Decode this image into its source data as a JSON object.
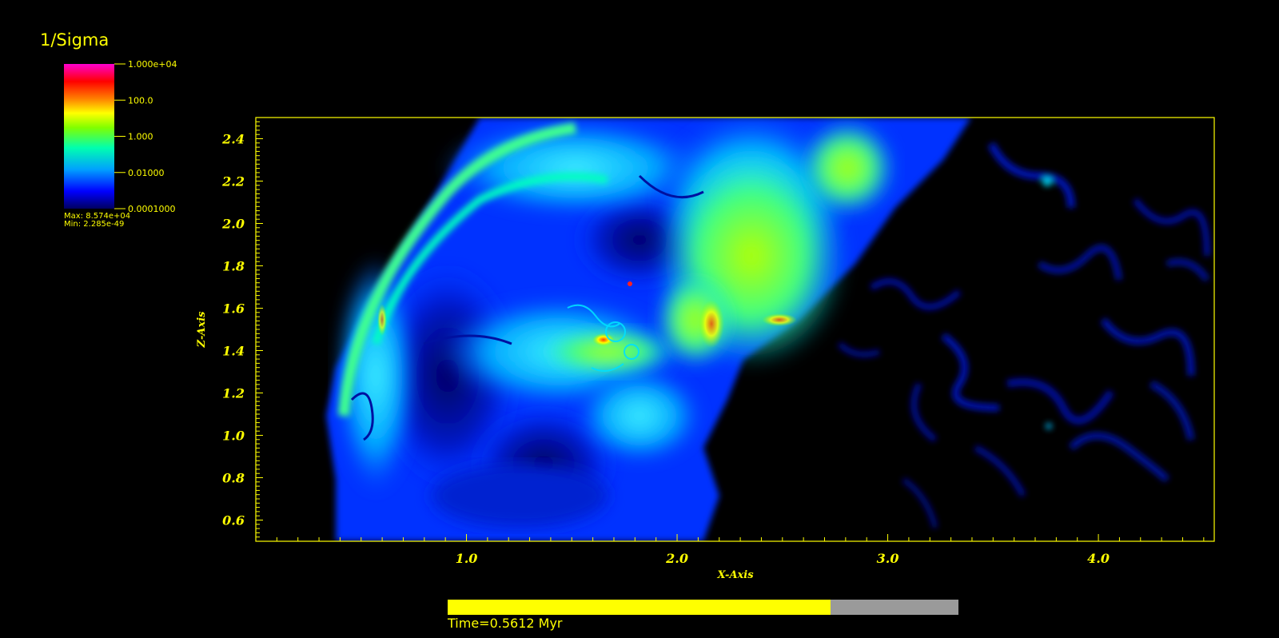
{
  "legend": {
    "title": "1/Sigma",
    "ticks": [
      "1.000e+04",
      "100.0",
      "1.000",
      "0.01000",
      "0.0001000"
    ],
    "max_label": "Max:  8.574e+04",
    "min_label": "Min:  2.285e-49"
  },
  "chart_data": {
    "type": "heatmap",
    "xlabel": "X-Axis",
    "ylabel": "Z-Axis",
    "xlim": [
      0.0,
      4.55
    ],
    "ylim": [
      0.5,
      2.5
    ],
    "x_ticks": [
      "1.0",
      "2.0",
      "3.0",
      "4.0"
    ],
    "y_ticks": [
      "0.6",
      "0.8",
      "1.0",
      "1.2",
      "1.4",
      "1.6",
      "1.8",
      "2.0",
      "2.2",
      "2.4"
    ],
    "colorbar": {
      "scale": "log",
      "range": [
        0.0001,
        10000
      ],
      "ticks": [
        10000,
        100,
        1,
        0.01,
        0.0001
      ],
      "colors": [
        "#000080",
        "#0000ff",
        "#00b4ff",
        "#00ff80",
        "#b4ff00",
        "#ff8000",
        "#ff0000",
        "#ff00c8"
      ]
    },
    "max": 85740,
    "min": 2.285e-49
  },
  "time": {
    "label": "Time=0.5612 Myr",
    "progress": 0.75
  },
  "colors": {
    "foreground": "#ffff00",
    "background": "#000000",
    "track": "#9a9a9a"
  }
}
